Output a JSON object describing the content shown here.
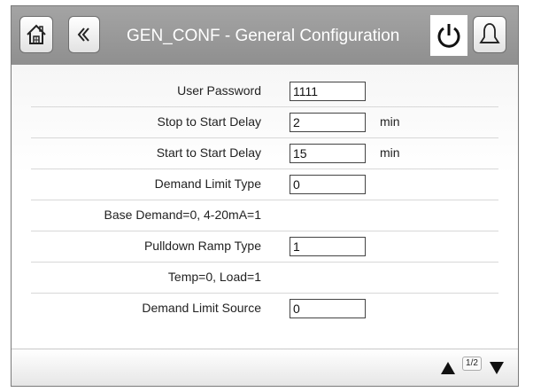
{
  "header": {
    "title": "GEN_CONF - General Configuration",
    "icons": {
      "home": "home-icon",
      "back": "back-chevron-icon",
      "power": "power-icon",
      "alarm": "bell-icon"
    }
  },
  "params": [
    {
      "label": "User Password",
      "value": "1111",
      "unit": ""
    },
    {
      "label": "Stop to Start Delay",
      "value": "2",
      "unit": "min"
    },
    {
      "label": "Start to Start Delay",
      "value": "15",
      "unit": "min"
    },
    {
      "label": "Demand Limit Type",
      "value": "0",
      "unit": ""
    },
    {
      "label": "Base Demand=0, 4-20mA=1"
    },
    {
      "label": "Pulldown Ramp Type",
      "value": "1",
      "unit": ""
    },
    {
      "label": "Temp=0, Load=1"
    },
    {
      "label": "Demand Limit Source",
      "value": "0",
      "unit": ""
    }
  ],
  "footer": {
    "page_indicator": "1/2"
  },
  "colors": {
    "header_bg": "#9a9a9a",
    "header_text": "#ffffff"
  }
}
